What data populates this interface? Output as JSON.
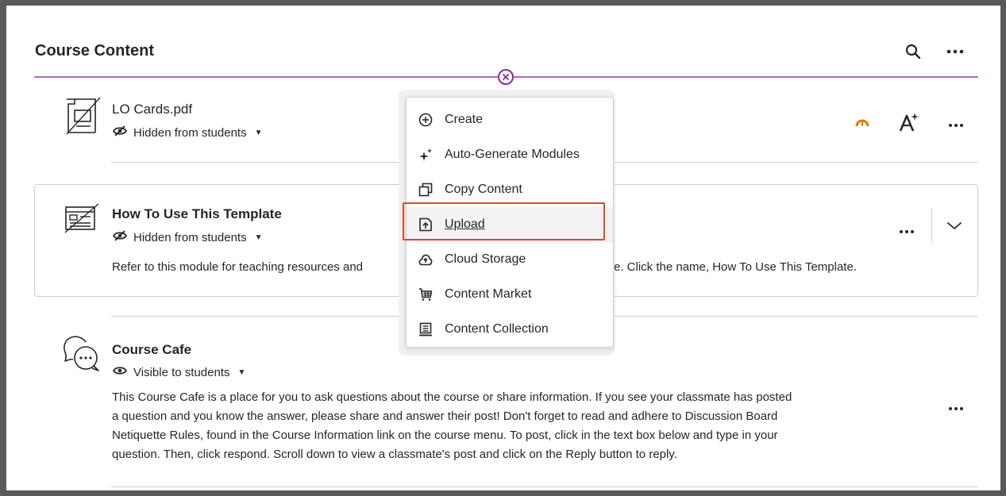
{
  "header": {
    "title": "Course Content"
  },
  "items": [
    {
      "title": "LO Cards.pdf",
      "visibility": "Hidden from students"
    },
    {
      "title": "How To Use This Template",
      "visibility": "Hidden from students",
      "description_left": "Refer to this module for teaching resources and",
      "description_right": "e. Click the name, How To Use This Template."
    },
    {
      "title": "Course Cafe",
      "visibility": "Visible to students",
      "description_lines": [
        "This Course Cafe is a place for you to ask questions about the course or share information. If you see your classmate has posted",
        "a question and you know the answer, please share and answer their post! Don't forget to read and adhere to Discussion Board",
        "Netiquette Rules, found in the Course Information link on the course menu. To post, click in the text box below and type in your",
        "question. Then, click respond. Scroll down to view a classmate's post and click on the Reply button to reply."
      ]
    }
  ],
  "menu": {
    "items": [
      {
        "label": "Create",
        "icon": "plus-circle-icon"
      },
      {
        "label": "Auto-Generate Modules",
        "icon": "sparkle-icon"
      },
      {
        "label": "Copy Content",
        "icon": "copy-icon"
      },
      {
        "label": "Upload",
        "icon": "upload-file-icon"
      },
      {
        "label": "Cloud Storage",
        "icon": "cloud-upload-icon"
      },
      {
        "label": "Content Market",
        "icon": "market-icon"
      },
      {
        "label": "Content Collection",
        "icon": "collection-icon"
      }
    ],
    "highlighted": "Upload"
  },
  "colors": {
    "accent_purple": "#8a2ba3",
    "divider_purple": "#b069c9",
    "highlight_red": "#e2472c",
    "gauge_orange": "#e07800"
  }
}
